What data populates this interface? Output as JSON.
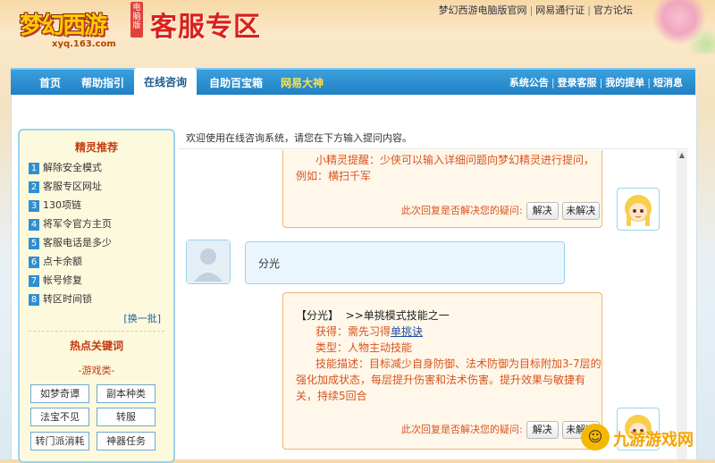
{
  "header": {
    "logo_text": "梦幻西游",
    "logo_tag": "电脑版",
    "logo_url": "xyq.163.com",
    "title": "客服专区",
    "top_links": [
      "梦幻西游电脑版官网",
      "网易通行证",
      "官方论坛"
    ]
  },
  "nav": {
    "tabs": [
      {
        "label": "首页"
      },
      {
        "label": "帮助指引"
      },
      {
        "label": "在线咨询",
        "active": true
      },
      {
        "label": "自助百宝箱"
      },
      {
        "label": "网易大神"
      }
    ],
    "right_links": [
      "系统公告",
      "登录客服",
      "我的提单",
      "短消息"
    ]
  },
  "sidebar": {
    "recommend_title": "精灵推荐",
    "items": [
      {
        "num": "1",
        "label": "解除安全模式"
      },
      {
        "num": "2",
        "label": "客服专区网址"
      },
      {
        "num": "3",
        "label": "130项链"
      },
      {
        "num": "4",
        "label": "将军令官方主页"
      },
      {
        "num": "5",
        "label": "客服电话是多少"
      },
      {
        "num": "6",
        "label": "点卡余额"
      },
      {
        "num": "7",
        "label": "帐号修复"
      },
      {
        "num": "8",
        "label": "转区时间锁"
      }
    ],
    "switch_label": "[换一批]",
    "keywords_title": "热点关键词",
    "keyword_category": "-游戏类-",
    "keywords": [
      "如梦奇谭",
      "副本种类",
      "法宝不见",
      "转服",
      "转门派消耗",
      "神器任务"
    ]
  },
  "content": {
    "welcome": "欢迎使用在线咨询系统，请您在下方输入提问内容。",
    "messages": [
      {
        "type": "system",
        "lines": [
          "小精灵提醒：少侠可以输入详细问题向梦幻精灵进行提问，",
          "例如：横扫千军"
        ],
        "feedback": "此次回复是否解决您的疑问:",
        "btn_yes": "解决",
        "btn_no": "未解决"
      },
      {
        "type": "user",
        "text": "分光"
      },
      {
        "type": "system",
        "head_title": "【分光】",
        "head_link": ">>单挑模式技能之一",
        "obtain_prefix": "获得：需先习得",
        "obtain_link": "单挑诀",
        "type_line": "类型：人物主动技能",
        "desc_lines": [
          "技能描述：目标减少自身防御、法术防御为目标附加3-7层的",
          "强化加成状态，每层提升伤害和法术伤害。提升效果与敏捷有",
          "关，持续5回合"
        ],
        "feedback": "此次回复是否解决您的疑问:",
        "btn_yes": "解决",
        "btn_no": "未解决"
      }
    ]
  },
  "watermark": "九游游戏网",
  "colors": {
    "nav_blue": "#1f7ec3",
    "accent_red": "#d9531e",
    "sidebar_bg": "#fdf9dd"
  }
}
